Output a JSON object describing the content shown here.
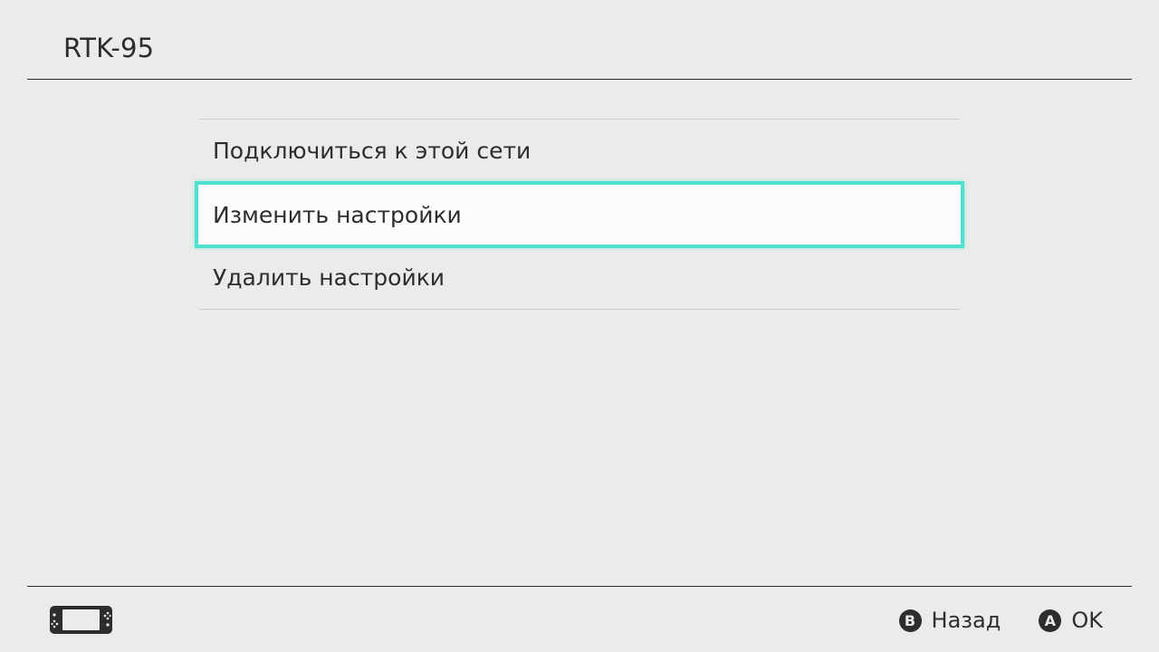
{
  "header": {
    "title": "RTK-95"
  },
  "menu": {
    "items": [
      {
        "label": "Подключиться к этой сети",
        "selected": false
      },
      {
        "label": "Изменить настройки",
        "selected": true
      },
      {
        "label": "Удалить настройки",
        "selected": false
      }
    ]
  },
  "footer": {
    "device_icon": "handheld-console-icon",
    "actions": [
      {
        "button": "B",
        "label": "Назад"
      },
      {
        "button": "A",
        "label": "OK"
      }
    ]
  },
  "colors": {
    "background": "#ebebeb",
    "text": "#2d2d2d",
    "selection_border": "#4fe0d2",
    "selection_fill": "#fcfcfc"
  }
}
